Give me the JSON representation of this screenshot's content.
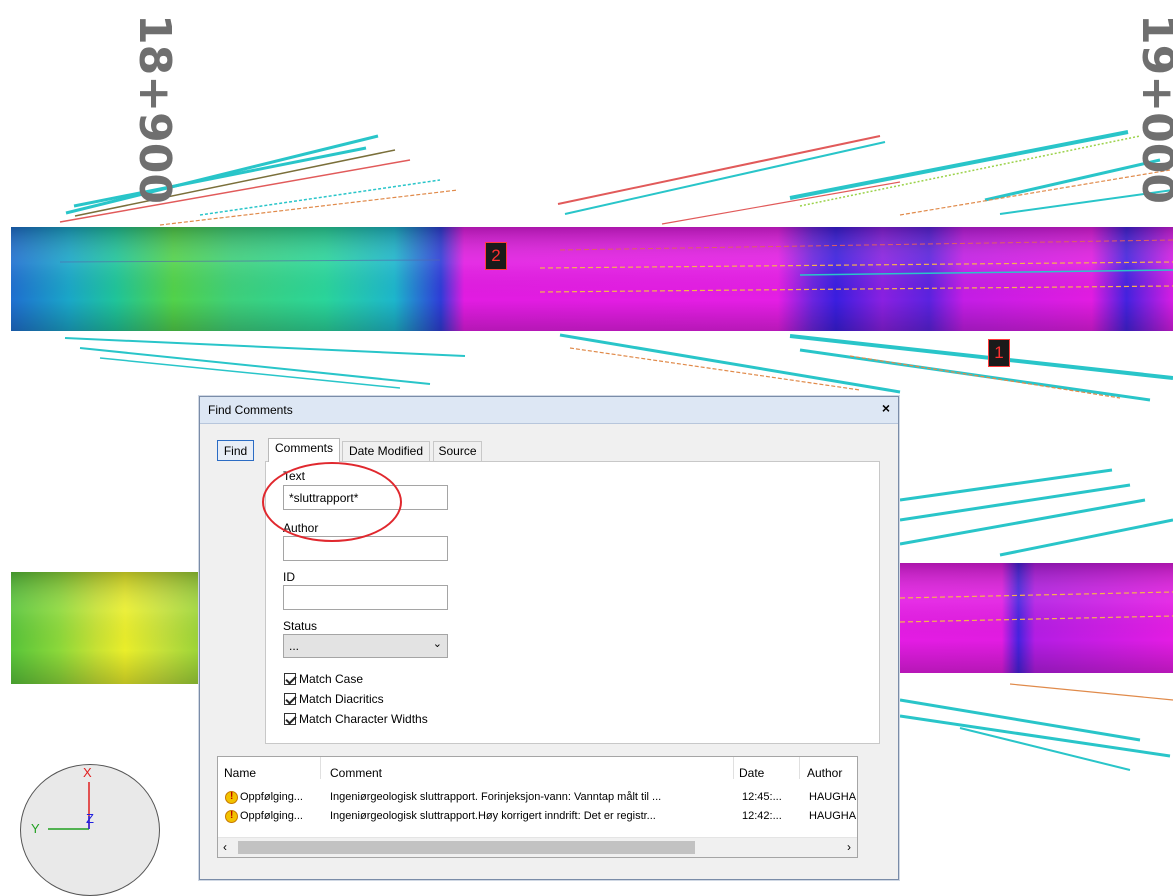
{
  "viewport": {
    "station_left": "18+900",
    "station_right": "19+000",
    "marker_1": "1",
    "marker_2": "2",
    "axes": {
      "x": "X",
      "y": "Y",
      "z": "Z"
    }
  },
  "dialog": {
    "title": "Find Comments",
    "close_icon": "×",
    "find_button": "Find",
    "tabs": [
      "Comments",
      "Date Modified",
      "Source"
    ],
    "fields": {
      "text_label": "Text",
      "text_value": "*sluttrapport*",
      "author_label": "Author",
      "author_value": "",
      "id_label": "ID",
      "id_value": "",
      "status_label": "Status",
      "status_value": "..."
    },
    "options": [
      {
        "label": "Match Case",
        "checked": true
      },
      {
        "label": "Match Diacritics",
        "checked": true
      },
      {
        "label": "Match Character Widths",
        "checked": true
      }
    ],
    "results": {
      "columns": [
        "Name",
        "Comment",
        "Date",
        "Author"
      ],
      "rows": [
        {
          "name": "Oppfølging...",
          "comment": "Ingeniørgeologisk sluttrapport. Forinjeksjon-vann: Vanntap målt til ...",
          "date": "12:45:...",
          "author": "HAUGHA"
        },
        {
          "name": "Oppfølging...",
          "comment": "Ingeniørgeologisk sluttrapport.Høy korrigert inndrift: Det er registr...",
          "date": "12:42:...",
          "author": "HAUGHA"
        }
      ]
    }
  }
}
